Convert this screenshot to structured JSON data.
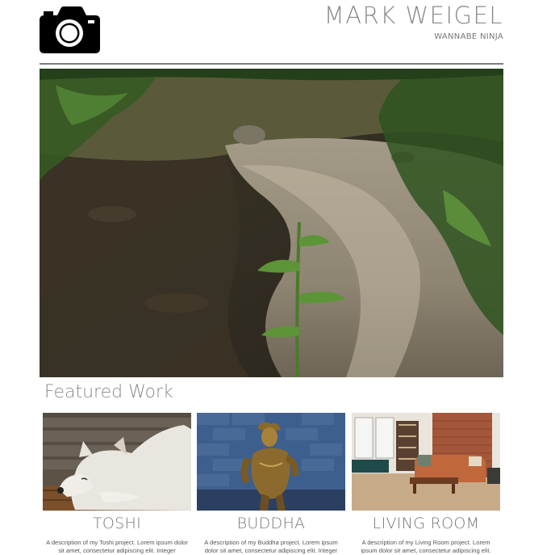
{
  "header": {
    "logo_icon": "camera-icon",
    "title": "MARK WEIGEL",
    "tagline": "WANNABE NINJA"
  },
  "hero": {
    "image": "creek-photo",
    "colors": {
      "water": "#8b8272",
      "rocks": "#4a4234",
      "foliage": "#3f6a2a"
    }
  },
  "featured": {
    "heading": "Featured Work",
    "items": [
      {
        "image": "white-dog-photo",
        "title": "TOSHI",
        "description": "A description of my Toshi project. Lorem ipsum dolor sit amet, consectetur adipiscing elit. Integer"
      },
      {
        "image": "buddha-statue-photo",
        "title": "BUDDHA",
        "description": "A description of my Buddha project. Lorem ipsum dolor sit amet, consectetur adipiscing elit. Integer"
      },
      {
        "image": "living-room-photo",
        "title": "LIVING ROOM",
        "description": "A description of my Living Room project. Lorem ipsum dolor sit amet, consectetur adipiscing elit."
      }
    ]
  }
}
